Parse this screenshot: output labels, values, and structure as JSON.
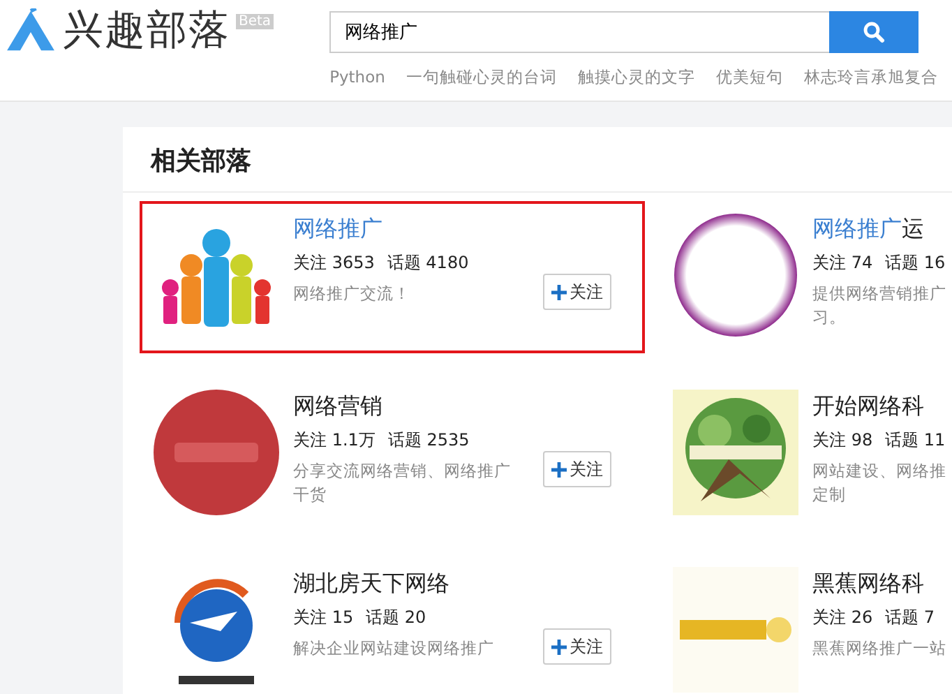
{
  "logo": {
    "title": "兴趣部落",
    "badge": "Beta"
  },
  "search": {
    "value": "网络推广"
  },
  "hot_links": [
    "Python",
    "一句触碰心灵的台词",
    "触摸心灵的文字",
    "优美短句",
    "林志玲言承旭复合"
  ],
  "section": {
    "title": "相关部落"
  },
  "tribes": [
    {
      "name_parts": [
        {
          "text": "网络推广",
          "match": true
        }
      ],
      "follows": "关注 3653",
      "topics": "话题 4180",
      "desc_lines": [
        "网络推广交流！"
      ],
      "highlighted": true,
      "follow_button": "关注"
    },
    {
      "name_parts": [
        {
          "text": "网络推广",
          "match": true
        },
        {
          "text": "运",
          "match": false
        }
      ],
      "follows": "关注 74",
      "topics": "话题 16",
      "desc_lines": [
        "提供网络营销推广",
        "习。"
      ],
      "highlighted": false
    },
    {
      "name_parts": [
        {
          "text": "网络营销",
          "match": false
        }
      ],
      "follows": "关注 1.1万",
      "topics": "话题 2535",
      "desc_lines": [
        "分享交流网络营销、网络推广",
        "干货"
      ],
      "highlighted": false,
      "follow_button": "关注"
    },
    {
      "name_parts": [
        {
          "text": "开始网络科",
          "match": false
        }
      ],
      "follows": "关注 98",
      "topics": "话题 11",
      "desc_lines": [
        "网站建设、网络推",
        "定制"
      ],
      "highlighted": false
    },
    {
      "name_parts": [
        {
          "text": "湖北房天下网络",
          "match": false
        }
      ],
      "follows": "关注 15",
      "topics": "话题 20",
      "desc_lines": [
        "解决企业网站建设网络推广"
      ],
      "highlighted": false,
      "follow_button": "关注"
    },
    {
      "name_parts": [
        {
          "text": "黑蕉网络科",
          "match": false
        }
      ],
      "follows": "关注 26",
      "topics": "话题 7",
      "desc_lines": [
        "黑蕉网络推广一站"
      ],
      "highlighted": false
    }
  ]
}
